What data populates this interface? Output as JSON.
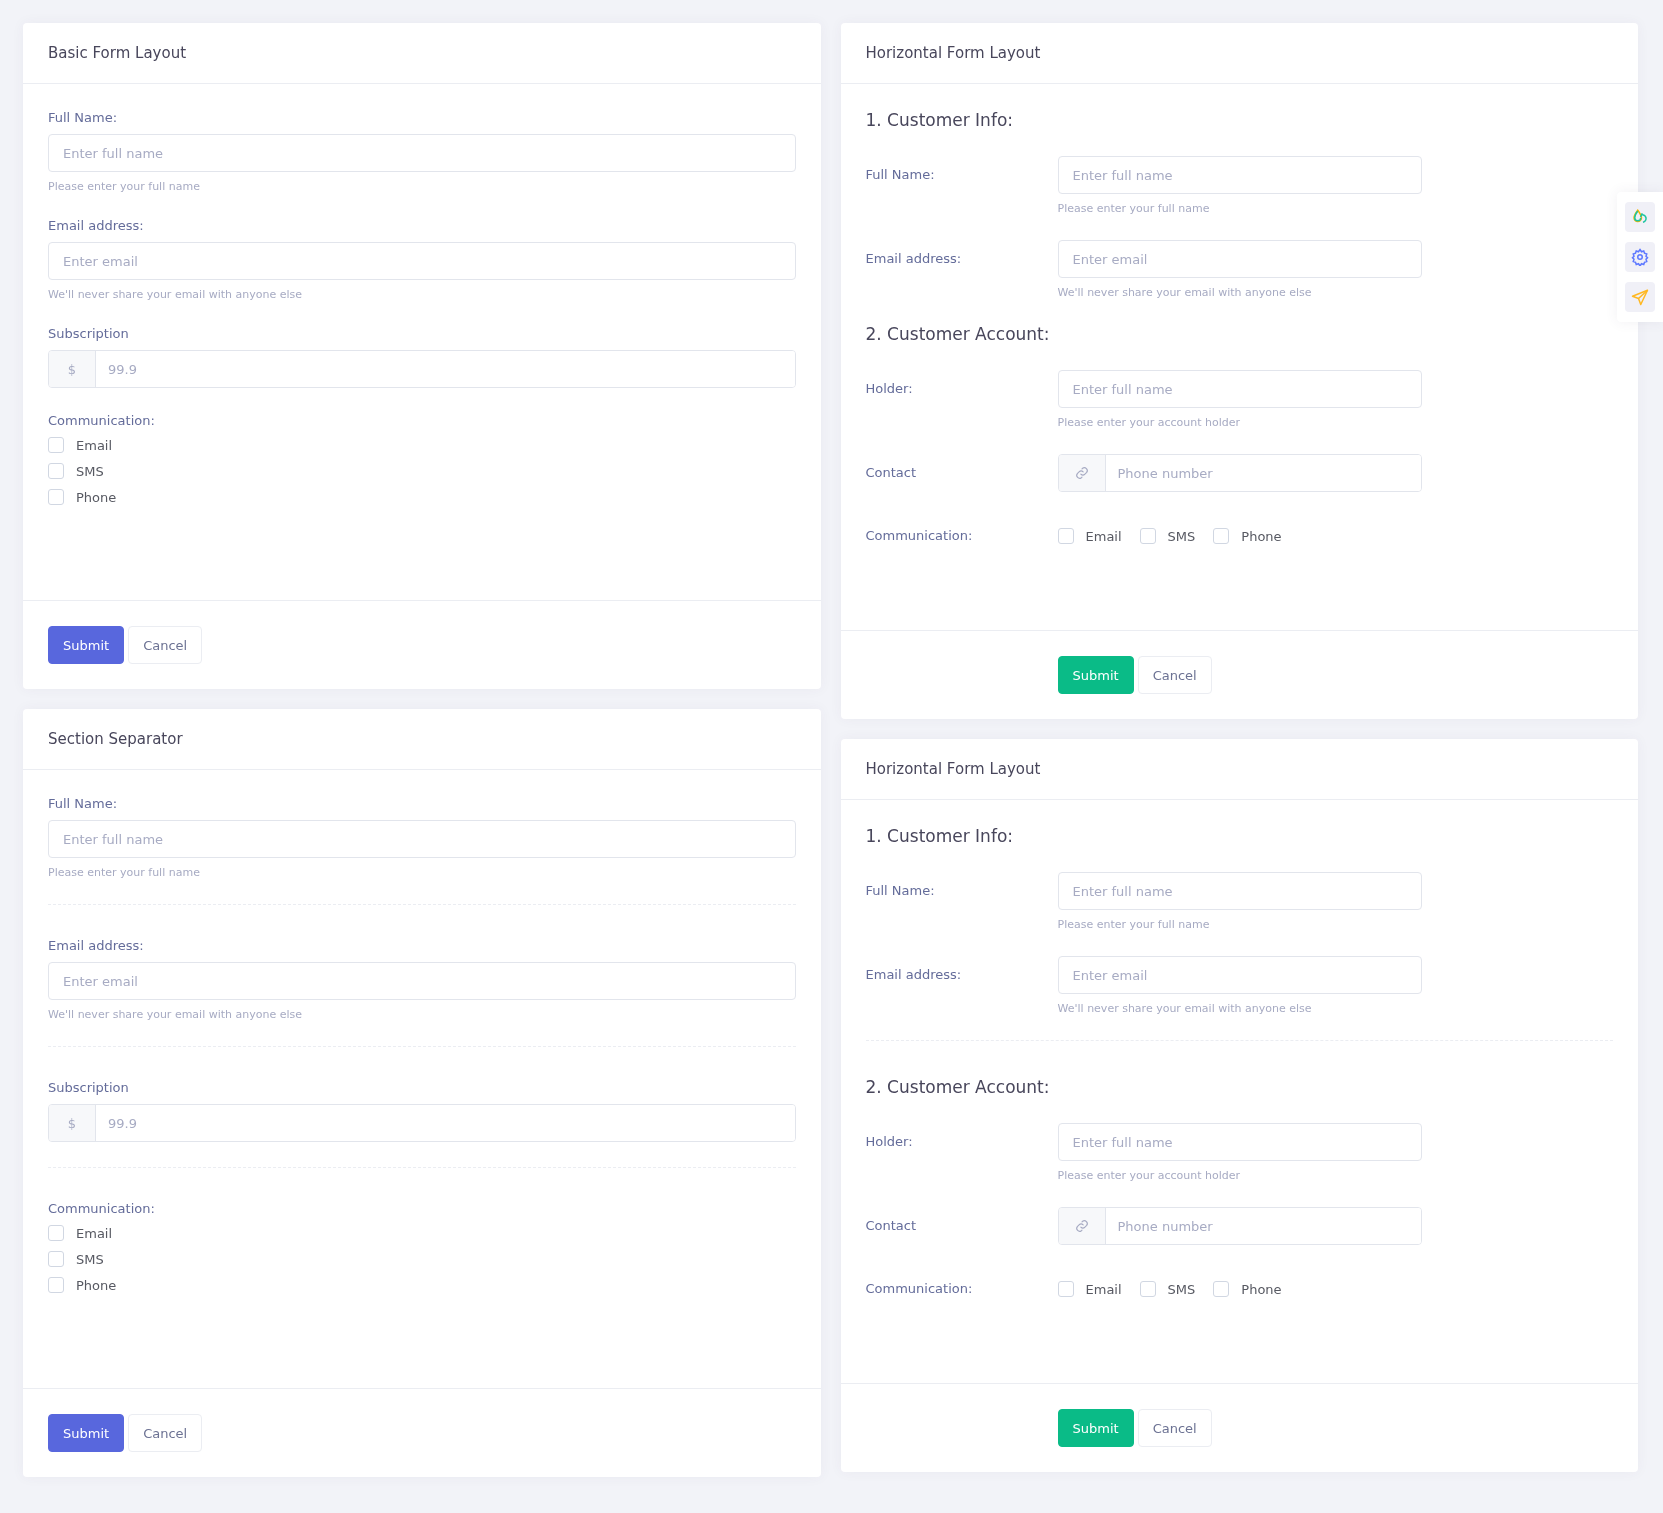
{
  "columns": [
    {
      "cards": [
        {
          "title": "Basic Form Layout",
          "kind": "vertical",
          "separated": false,
          "groups": [
            {
              "fields": [
                {
                  "kind": "text",
                  "label": "Full Name:",
                  "placeholder": "Enter full name",
                  "help": "Please enter your full name"
                },
                {
                  "kind": "text",
                  "label": "Email address:",
                  "placeholder": "Enter email",
                  "help": "We'll never share your email with anyone else"
                },
                {
                  "kind": "addon-text",
                  "label": "Subscription",
                  "addon": "$",
                  "placeholder": "99.9"
                },
                {
                  "kind": "checks",
                  "label": "Communication:",
                  "options": [
                    {
                      "label": "Email",
                      "checked": false
                    },
                    {
                      "label": "SMS",
                      "checked": false
                    },
                    {
                      "label": "Phone",
                      "checked": false
                    }
                  ]
                }
              ]
            }
          ],
          "buttons": [
            {
              "label": "Submit"
            },
            {
              "label": "Cancel"
            }
          ]
        },
        {
          "title": "Section Separator",
          "kind": "vertical",
          "separated": true,
          "groups": [
            {
              "fields": [
                {
                  "kind": "text",
                  "label": "Full Name:",
                  "placeholder": "Enter full name",
                  "help": "Please enter your full name"
                },
                {
                  "kind": "text",
                  "label": "Email address:",
                  "placeholder": "Enter email",
                  "help": "We'll never share your email with anyone else"
                },
                {
                  "kind": "addon-text",
                  "label": "Subscription",
                  "addon": "$",
                  "placeholder": "99.9"
                },
                {
                  "kind": "checks",
                  "label": "Communication:",
                  "options": [
                    {
                      "label": "Email",
                      "checked": false
                    },
                    {
                      "label": "SMS",
                      "checked": false
                    },
                    {
                      "label": "Phone",
                      "checked": false
                    }
                  ]
                }
              ]
            }
          ],
          "buttons": [
            {
              "label": "Submit"
            },
            {
              "label": "Cancel"
            }
          ]
        }
      ]
    },
    {
      "cards": [
        {
          "title": "Horizontal Form Layout",
          "kind": "horizontal",
          "separated": false,
          "groups": [
            {
              "heading": "1. Customer Info:",
              "fields": [
                {
                  "kind": "text",
                  "label": "Full Name:",
                  "placeholder": "Enter full name",
                  "help": "Please enter your full name"
                },
                {
                  "kind": "text",
                  "label": "Email address:",
                  "placeholder": "Enter email",
                  "help": "We'll never share your email with anyone else"
                }
              ]
            },
            {
              "heading": "2. Customer Account:",
              "fields": [
                {
                  "kind": "text",
                  "label": "Holder:",
                  "placeholder": "Enter full name",
                  "help": "Please enter your account holder"
                },
                {
                  "kind": "addon-icon",
                  "label": "Contact",
                  "placeholder": "Phone number"
                },
                {
                  "kind": "checks",
                  "label": "Communication:",
                  "options": [
                    {
                      "label": "Email",
                      "checked": false
                    },
                    {
                      "label": "SMS",
                      "checked": false
                    },
                    {
                      "label": "Phone",
                      "checked": false
                    }
                  ]
                }
              ]
            }
          ],
          "buttons": [
            {
              "label": "Submit"
            },
            {
              "label": "Cancel"
            }
          ]
        },
        {
          "title": "Horizontal Form Layout",
          "kind": "horizontal",
          "separated": true,
          "groups": [
            {
              "heading": "1. Customer Info:",
              "fields": [
                {
                  "kind": "text",
                  "label": "Full Name:",
                  "placeholder": "Enter full name",
                  "help": "Please enter your full name"
                },
                {
                  "kind": "text",
                  "label": "Email address:",
                  "placeholder": "Enter email",
                  "help": "We'll never share your email with anyone else"
                }
              ]
            },
            {
              "heading": "2. Customer Account:",
              "fields": [
                {
                  "kind": "text",
                  "label": "Holder:",
                  "placeholder": "Enter full name",
                  "help": "Please enter your account holder"
                },
                {
                  "kind": "addon-icon",
                  "label": "Contact",
                  "placeholder": "Phone number"
                },
                {
                  "kind": "checks",
                  "label": "Communication:",
                  "options": [
                    {
                      "label": "Email",
                      "checked": false
                    },
                    {
                      "label": "SMS",
                      "checked": false
                    },
                    {
                      "label": "Phone",
                      "checked": false
                    }
                  ]
                }
              ]
            }
          ],
          "buttons": [
            {
              "label": "Submit"
            },
            {
              "label": "Cancel"
            }
          ]
        }
      ]
    }
  ]
}
